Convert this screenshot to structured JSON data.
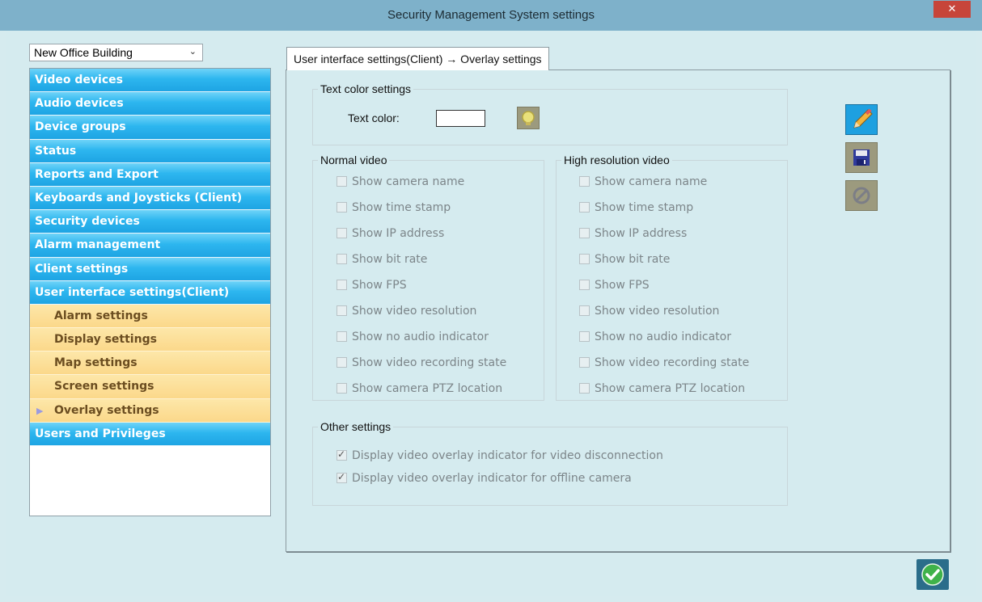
{
  "window": {
    "title": "Security Management System settings",
    "close_glyph": "✕"
  },
  "site_select": {
    "value": "New Office Building"
  },
  "nav": {
    "items": [
      {
        "label": "Video devices",
        "type": "category"
      },
      {
        "label": "Audio devices",
        "type": "category"
      },
      {
        "label": "Device groups",
        "type": "category"
      },
      {
        "label": "Status",
        "type": "category"
      },
      {
        "label": "Reports and Export",
        "type": "category"
      },
      {
        "label": "Keyboards and Joysticks (Client)",
        "type": "category"
      },
      {
        "label": "Security devices",
        "type": "category"
      },
      {
        "label": "Alarm management",
        "type": "category"
      },
      {
        "label": "Client settings",
        "type": "category"
      },
      {
        "label": "User interface settings(Client)",
        "type": "category",
        "expanded": true
      },
      {
        "label": "Alarm settings",
        "type": "sub"
      },
      {
        "label": "Display settings",
        "type": "sub"
      },
      {
        "label": "Map settings",
        "type": "sub"
      },
      {
        "label": "Screen settings",
        "type": "sub"
      },
      {
        "label": "Overlay settings",
        "type": "sub",
        "selected": true
      },
      {
        "label": "Users and Privileges",
        "type": "category"
      }
    ]
  },
  "tab": {
    "label": "User interface settings(Client) → Overlay settings"
  },
  "text_color": {
    "legend": "Text color settings",
    "label": "Text color:",
    "value_color": "#ffffff"
  },
  "normal_video": {
    "legend": "Normal video",
    "options": [
      {
        "label": "Show camera name",
        "checked": false
      },
      {
        "label": "Show time stamp",
        "checked": false
      },
      {
        "label": "Show IP address",
        "checked": false
      },
      {
        "label": "Show bit rate",
        "checked": false
      },
      {
        "label": "Show FPS",
        "checked": false
      },
      {
        "label": "Show video resolution",
        "checked": false
      },
      {
        "label": "Show no audio indicator",
        "checked": false
      },
      {
        "label": "Show video recording state",
        "checked": false
      },
      {
        "label": "Show camera PTZ location",
        "checked": false
      }
    ]
  },
  "high_res_video": {
    "legend": "High resolution video",
    "options": [
      {
        "label": "Show camera name",
        "checked": false
      },
      {
        "label": "Show time stamp",
        "checked": false
      },
      {
        "label": "Show IP address",
        "checked": false
      },
      {
        "label": "Show bit rate",
        "checked": false
      },
      {
        "label": "Show FPS",
        "checked": false
      },
      {
        "label": "Show video resolution",
        "checked": false
      },
      {
        "label": "Show no audio indicator",
        "checked": false
      },
      {
        "label": "Show video recording state",
        "checked": false
      },
      {
        "label": "Show camera PTZ location",
        "checked": false
      }
    ]
  },
  "other_settings": {
    "legend": "Other settings",
    "options": [
      {
        "label": "Display video overlay indicator for video disconnection",
        "checked": true
      },
      {
        "label": "Display video overlay indicator for offline camera",
        "checked": true
      }
    ]
  },
  "colors": {
    "nav_category": "#29b2ec",
    "nav_sub": "#fcdf9a",
    "panel_bg": "#d5ebef",
    "title_bar": "#7eb1ca",
    "close": "#c7453a"
  }
}
